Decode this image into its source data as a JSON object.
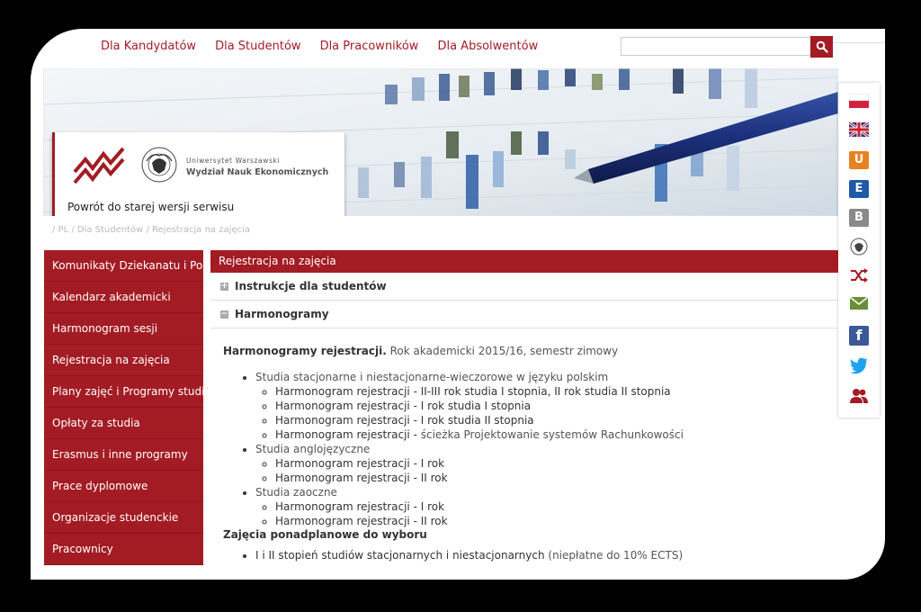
{
  "top_nav": [
    "Dla Kandydatów",
    "Dla Studentów",
    "Dla Pracowników",
    "Dla Absolwentów"
  ],
  "search": {
    "placeholder": ""
  },
  "logo": {
    "university": "Uniwersytet Warszawski",
    "faculty": "Wydział Nauk Ekonomicznych",
    "seal_text": "UNIVERSITAS VARSOVIENSIS"
  },
  "back_link": "Powrót do starej wersji serwisu",
  "side_icons": [
    "flag-pl-icon",
    "flag-uk-icon",
    "usosweb-icon",
    "elearning-icon",
    "blog-icon",
    "university-seal-icon",
    "shuffle-icon",
    "mail-icon",
    "facebook-icon",
    "twitter-icon",
    "people-icon"
  ],
  "breadcrumb": "/ PL / Dla Studentów / Rejestracja na zajęcia",
  "sidebar": {
    "items": [
      "Komunikaty Dziekanatu i Porad",
      "Kalendarz akademicki",
      "Harmonogram sesji",
      "Rejestracja na zajęcia",
      "Plany zajęć i Programy studiów",
      "Opłaty za studia",
      "Erasmus i inne programy",
      "Prace dyplomowe",
      "Organizacje studenckie",
      "Pracownicy"
    ]
  },
  "content": {
    "header": "Rejestracja na zajęcia",
    "accordion": [
      {
        "label": "Instrukcje dla studentów",
        "state": "+"
      },
      {
        "label": "Harmonogramy",
        "state": "−"
      }
    ],
    "heading_bold": "Harmonogramy rejestracji.",
    "heading_rest": " Rok akademicki 2015/16, semestr zimowy",
    "sections": [
      {
        "title": "Studia stacjonarne i niestacjonarne-wieczorowe w języku polskim",
        "items": [
          {
            "link": "Harmonogram rejestracji - II-III rok studia I stopnia, II rok studia II stopnia",
            "rest": ""
          },
          {
            "link": "Harmonogram rejestracji - I rok studia I stopnia",
            "rest": ""
          },
          {
            "link": "Harmonogram rejestracji - I rok studia II stopnia",
            "rest": ""
          },
          {
            "link": "Harmonogram rejestracji -",
            "rest": " ścieżka Projektowanie systemów Rachunkowości"
          }
        ]
      },
      {
        "title": "Studia anglojęzyczne",
        "items": [
          {
            "link": "Harmonogram rejestracji - I rok",
            "rest": ""
          },
          {
            "link": "Harmonogram rejestracji - II rok",
            "rest": ""
          }
        ]
      },
      {
        "title": "Studia zaoczne",
        "items": [
          {
            "link": "Harmonogram rejestracji - I rok",
            "rest": ""
          },
          {
            "link": "Harmonogram rejestracji - II rok",
            "rest": ""
          }
        ]
      }
    ],
    "extra_heading": "Zajęcia ponadplanowe do wyboru",
    "extra_item_link": "I i II stopień studiów stacjonarnych i niestacjonarnych",
    "extra_item_note": " (niepłatne do 10% ECTS)"
  },
  "colors": {
    "brand_red": "#a31c24",
    "text": "#333333",
    "muted": "#bbbbbb"
  }
}
